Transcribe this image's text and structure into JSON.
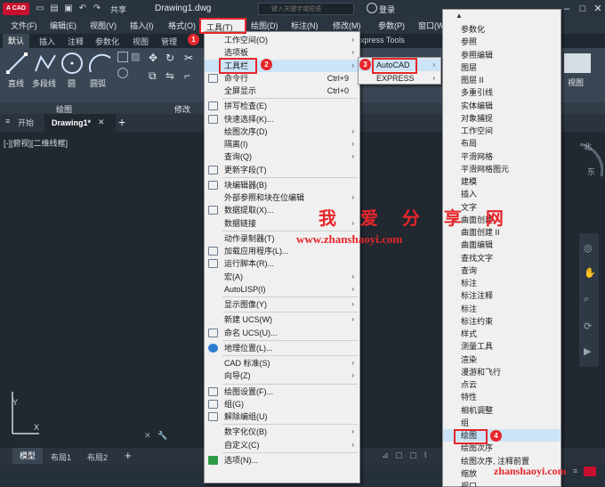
{
  "titlebar": {
    "logo": "A CAD",
    "share": "共享",
    "doc_title": "Drawing1.dwg",
    "search_placeholder": "键入关键字或短语",
    "login": "登录"
  },
  "menubar": [
    "文件(F)",
    "编辑(E)",
    "视图(V)",
    "插入(I)",
    "格式(O)",
    "工具(T)",
    "绘图(D)",
    "标注(N)",
    "修改(M)",
    "参数(P)",
    "窗口(W)"
  ],
  "ribbon": {
    "tabs": [
      "默认",
      "插入",
      "注释",
      "参数化",
      "视图",
      "管理",
      "输出",
      "附加模块",
      "协作",
      "Express Tools"
    ],
    "tools": [
      "直线",
      "多段线",
      "圆",
      "圆弧"
    ],
    "panel_draw": "绘图",
    "panel_modify": "修改",
    "view_button": "视图"
  },
  "doctabs": {
    "start": "开始",
    "drawing": "Drawing1*"
  },
  "viewport_label": "[-][俯视][二维线框]",
  "viewcube": {
    "north": "北",
    "east": "东"
  },
  "layout_tabs": [
    "模型",
    "布局1",
    "布局2"
  ],
  "tools_menu": {
    "title": "工具(T)",
    "items": [
      {
        "label": "工作空间(O)",
        "arrow": true
      },
      {
        "label": "选项板",
        "arrow": true
      },
      {
        "label": "工具栏",
        "arrow": true
      },
      {
        "label": "命令行",
        "shortcut": "Ctrl+9"
      },
      {
        "label": "全屏显示",
        "shortcut": "Ctrl+0"
      },
      {
        "label": "拼写检查(E)"
      },
      {
        "label": "快速选择(K)..."
      },
      {
        "label": "绘图次序(D)",
        "arrow": true
      },
      {
        "label": "隔离(I)",
        "arrow": true
      },
      {
        "label": "查询(Q)",
        "arrow": true
      },
      {
        "label": "更新字段(T)"
      },
      {
        "label": "块编辑器(B)"
      },
      {
        "label": "外部参照和块在位编辑",
        "arrow": true
      },
      {
        "label": "数据提取(X)..."
      },
      {
        "label": "数据链接",
        "arrow": true
      },
      {
        "label": "动作录制器(T)",
        "arrow": true
      },
      {
        "label": "加载应用程序(L)..."
      },
      {
        "label": "运行脚本(R)..."
      },
      {
        "label": "宏(A)",
        "arrow": true
      },
      {
        "label": "AutoLISP(I)",
        "arrow": true
      },
      {
        "label": "显示图像(Y)",
        "arrow": true
      },
      {
        "label": "新建 UCS(W)",
        "arrow": true
      },
      {
        "label": "命名 UCS(U)..."
      },
      {
        "label": "地理位置(L)..."
      },
      {
        "label": "CAD 标准(S)",
        "arrow": true
      },
      {
        "label": "向导(Z)",
        "arrow": true
      },
      {
        "label": "绘图设置(F)..."
      },
      {
        "label": "组(G)"
      },
      {
        "label": "解除编组(U)"
      },
      {
        "label": "数字化仪(B)",
        "arrow": true
      },
      {
        "label": "自定义(C)",
        "arrow": true
      },
      {
        "label": "选项(N)..."
      }
    ]
  },
  "toolbar_sub": [
    "AutoCAD",
    "EXPRESS"
  ],
  "acad_sub": [
    "参数化",
    "参照",
    "参照编辑",
    "图层",
    "图层 II",
    "多重引线",
    "实体编辑",
    "对象捕捉",
    "工作空间",
    "布局",
    "平滑网格",
    "平滑网格图元",
    "建模",
    "插入",
    "文字",
    "曲面创建",
    "曲面创建 II",
    "曲面编辑",
    "查找文字",
    "查询",
    "标注",
    "标注注释",
    "标注",
    "标注约束",
    "样式",
    "测量工具",
    "渲染",
    "漫游和飞行",
    "点云",
    "特性",
    "相机调整",
    "组",
    "绘图",
    "绘图次序",
    "绘图次序, 注释前置",
    "缩放",
    "视口"
  ],
  "badges": [
    "1",
    "2",
    "3",
    "4"
  ],
  "watermark": {
    "title": "我 爱 分 享 网",
    "url": "www.zhanshaoyi.com",
    "corner": "zhanshaoyi.com"
  },
  "colors": {
    "accent_red": "#e6262b",
    "highlight": "#cce4f7"
  }
}
